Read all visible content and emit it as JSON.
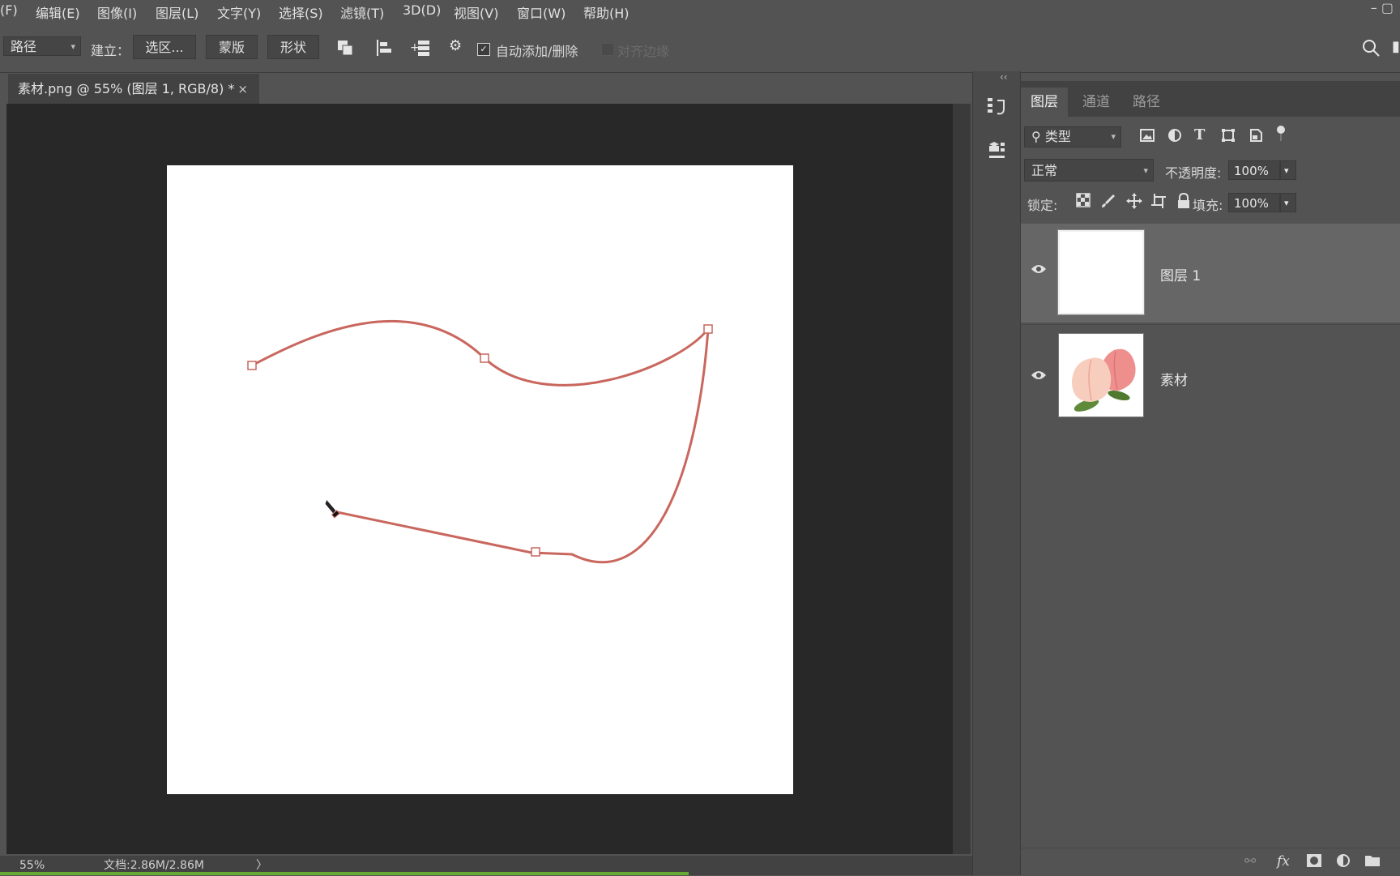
{
  "menu": {
    "items": [
      "(F)",
      "编辑(E)",
      "图像(I)",
      "图层(L)",
      "文字(Y)",
      "选择(S)",
      "滤镜(T)",
      "3D(D)",
      "视图(V)",
      "窗口(W)",
      "帮助(H)"
    ]
  },
  "window_controls": "– ▢",
  "options_bar": {
    "mode_select": "路径",
    "make_label": "建立：",
    "selection_button": "选区...",
    "mask_button": "蒙版",
    "shape_button": "形状",
    "auto_add_delete_label": "自动添加/删除",
    "align_edges_label": "对齐边缘",
    "auto_add_checked": true
  },
  "document": {
    "tab_title": "素材.png @ 55% (图层 1, RGB/8) *",
    "close_symbol": "×",
    "zoom": "55%",
    "doc_info": "文档:2.86M/2.86M",
    "status_arrow": "〉"
  },
  "layers_panel": {
    "tabs": [
      "图层",
      "通道",
      "路径"
    ],
    "filter_label": "类型",
    "blend_mode": "正常",
    "opacity_label": "不透明度:",
    "opacity_value": "100%",
    "lock_label": "锁定:",
    "fill_label": "填充:",
    "fill_value": "100%",
    "layers": [
      {
        "name": "图层 1",
        "visible": true,
        "selected": true
      },
      {
        "name": "素材",
        "visible": true,
        "selected": false
      }
    ]
  },
  "colors": {
    "path_stroke": "#c9675e",
    "background": "#535353",
    "canvas_bg": "#282828"
  }
}
